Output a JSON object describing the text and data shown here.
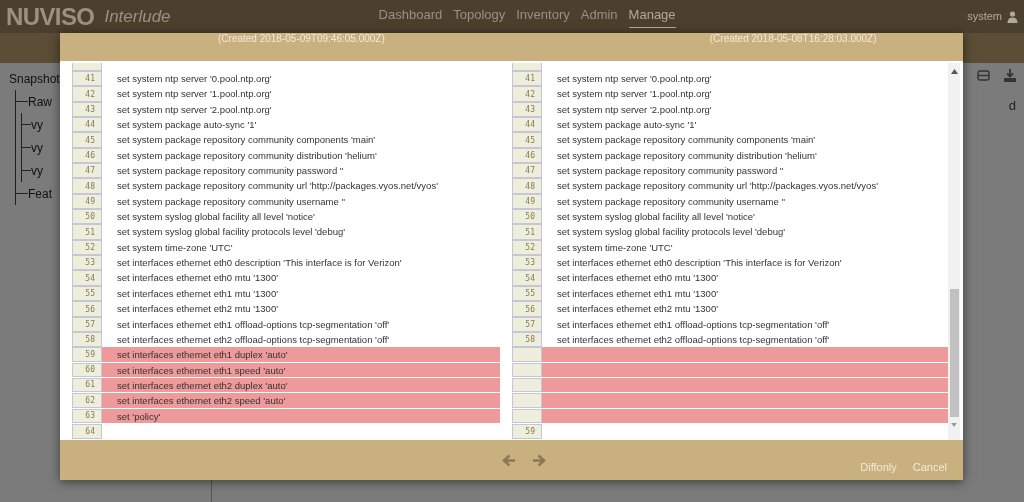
{
  "app": {
    "logo": "NUVISO",
    "product": "Interlude",
    "nav": [
      {
        "label": "Dashboard",
        "selected": false
      },
      {
        "label": "Topology",
        "selected": false
      },
      {
        "label": "Inventory",
        "selected": false
      },
      {
        "label": "Admin",
        "selected": false
      },
      {
        "label": "Manage",
        "selected": true
      }
    ],
    "user": "system"
  },
  "background": {
    "tree": [
      {
        "label": "Snapshot",
        "children": [
          {
            "label": "Raw",
            "children": [
              {
                "label": "vy"
              },
              {
                "label": "vy"
              },
              {
                "label": "vy"
              }
            ]
          },
          {
            "label": "Feat"
          }
        ]
      }
    ],
    "column_label": "d"
  },
  "modal": {
    "left_title": "(Created 2018-05-09T09:46:05.000Z)",
    "right_title": "(Created 2018-05-08T16:28:03.000Z)",
    "left": [
      {
        "num": "41",
        "text": "set system ntp server '0.pool.ntp.org'",
        "changed": false
      },
      {
        "num": "42",
        "text": "set system ntp server '1.pool.ntp.org'",
        "changed": false
      },
      {
        "num": "43",
        "text": "set system ntp server '2.pool.ntp.org'",
        "changed": false
      },
      {
        "num": "44",
        "text": "set system package auto-sync '1'",
        "changed": false
      },
      {
        "num": "45",
        "text": "set system package repository community components 'main'",
        "changed": false
      },
      {
        "num": "46",
        "text": "set system package repository community distribution 'helium'",
        "changed": false
      },
      {
        "num": "47",
        "text": "set system package repository community password ''",
        "changed": false
      },
      {
        "num": "48",
        "text": "set system package repository community url 'http://packages.vyos.net/vyos'",
        "changed": false
      },
      {
        "num": "49",
        "text": "set system package repository community username ''",
        "changed": false
      },
      {
        "num": "50",
        "text": "set system syslog global facility all level 'notice'",
        "changed": false
      },
      {
        "num": "51",
        "text": "set system syslog global facility protocols level 'debug'",
        "changed": false
      },
      {
        "num": "52",
        "text": "set system time-zone 'UTC'",
        "changed": false
      },
      {
        "num": "53",
        "text": "set interfaces ethernet eth0 description 'This interface is for Verizon'",
        "changed": false
      },
      {
        "num": "54",
        "text": "set interfaces ethernet eth0 mtu '1300'",
        "changed": false
      },
      {
        "num": "55",
        "text": "set interfaces ethernet eth1 mtu '1300'",
        "changed": false
      },
      {
        "num": "56",
        "text": "set interfaces ethernet eth2 mtu '1300'",
        "changed": false
      },
      {
        "num": "57",
        "text": "set interfaces ethernet eth1 offload-options tcp-segmentation 'off'",
        "changed": false
      },
      {
        "num": "58",
        "text": "set interfaces ethernet eth2 offload-options tcp-segmentation 'off'",
        "changed": false
      },
      {
        "num": "59",
        "text": "set interfaces ethernet eth1 duplex 'auto'",
        "changed": true
      },
      {
        "num": "60",
        "text": "set interfaces ethernet eth1 speed 'auto'",
        "changed": true
      },
      {
        "num": "61",
        "text": "set interfaces ethernet eth2 duplex 'auto'",
        "changed": true
      },
      {
        "num": "62",
        "text": "set interfaces ethernet eth2 speed 'auto'",
        "changed": true
      },
      {
        "num": "63",
        "text": "set 'policy'",
        "changed": true
      },
      {
        "num": "64",
        "changed": false
      }
    ],
    "right": [
      {
        "num": "41",
        "text": "set system ntp server '0.pool.ntp.org'",
        "changed": false
      },
      {
        "num": "42",
        "text": "set system ntp server '1.pool.ntp.org'",
        "changed": false
      },
      {
        "num": "43",
        "text": "set system ntp server '2.pool.ntp.org'",
        "changed": false
      },
      {
        "num": "44",
        "text": "set system package auto-sync '1'",
        "changed": false
      },
      {
        "num": "45",
        "text": "set system package repository community components 'main'",
        "changed": false
      },
      {
        "num": "46",
        "text": "set system package repository community distribution 'helium'",
        "changed": false
      },
      {
        "num": "47",
        "text": "set system package repository community password ''",
        "changed": false
      },
      {
        "num": "48",
        "text": "set system package repository community url 'http://packages.vyos.net/vyos'",
        "changed": false
      },
      {
        "num": "49",
        "text": "set system package repository community username ''",
        "changed": false
      },
      {
        "num": "50",
        "text": "set system syslog global facility all level 'notice'",
        "changed": false
      },
      {
        "num": "51",
        "text": "set system syslog global facility protocols level 'debug'",
        "changed": false
      },
      {
        "num": "52",
        "text": "set system time-zone 'UTC'",
        "changed": false
      },
      {
        "num": "53",
        "text": "set interfaces ethernet eth0 description 'This interface is for Verizon'",
        "changed": false
      },
      {
        "num": "54",
        "text": "set interfaces ethernet eth0 mtu '1300'",
        "changed": false
      },
      {
        "num": "55",
        "text": "set interfaces ethernet eth1 mtu '1300'",
        "changed": false
      },
      {
        "num": "56",
        "text": "set interfaces ethernet eth2 mtu '1300'",
        "changed": false
      },
      {
        "num": "57",
        "text": "set interfaces ethernet eth1 offload-options tcp-segmentation 'off'",
        "changed": false
      },
      {
        "num": "58",
        "text": "set interfaces ethernet eth2 offload-options tcp-segmentation 'off'",
        "changed": false
      },
      {
        "changed": true
      },
      {
        "changed": true
      },
      {
        "changed": true
      },
      {
        "changed": true
      },
      {
        "changed": true
      },
      {
        "num": "59",
        "changed": false
      }
    ],
    "buttons": [
      {
        "label": "Diffonly"
      },
      {
        "label": "Cancel"
      }
    ]
  }
}
